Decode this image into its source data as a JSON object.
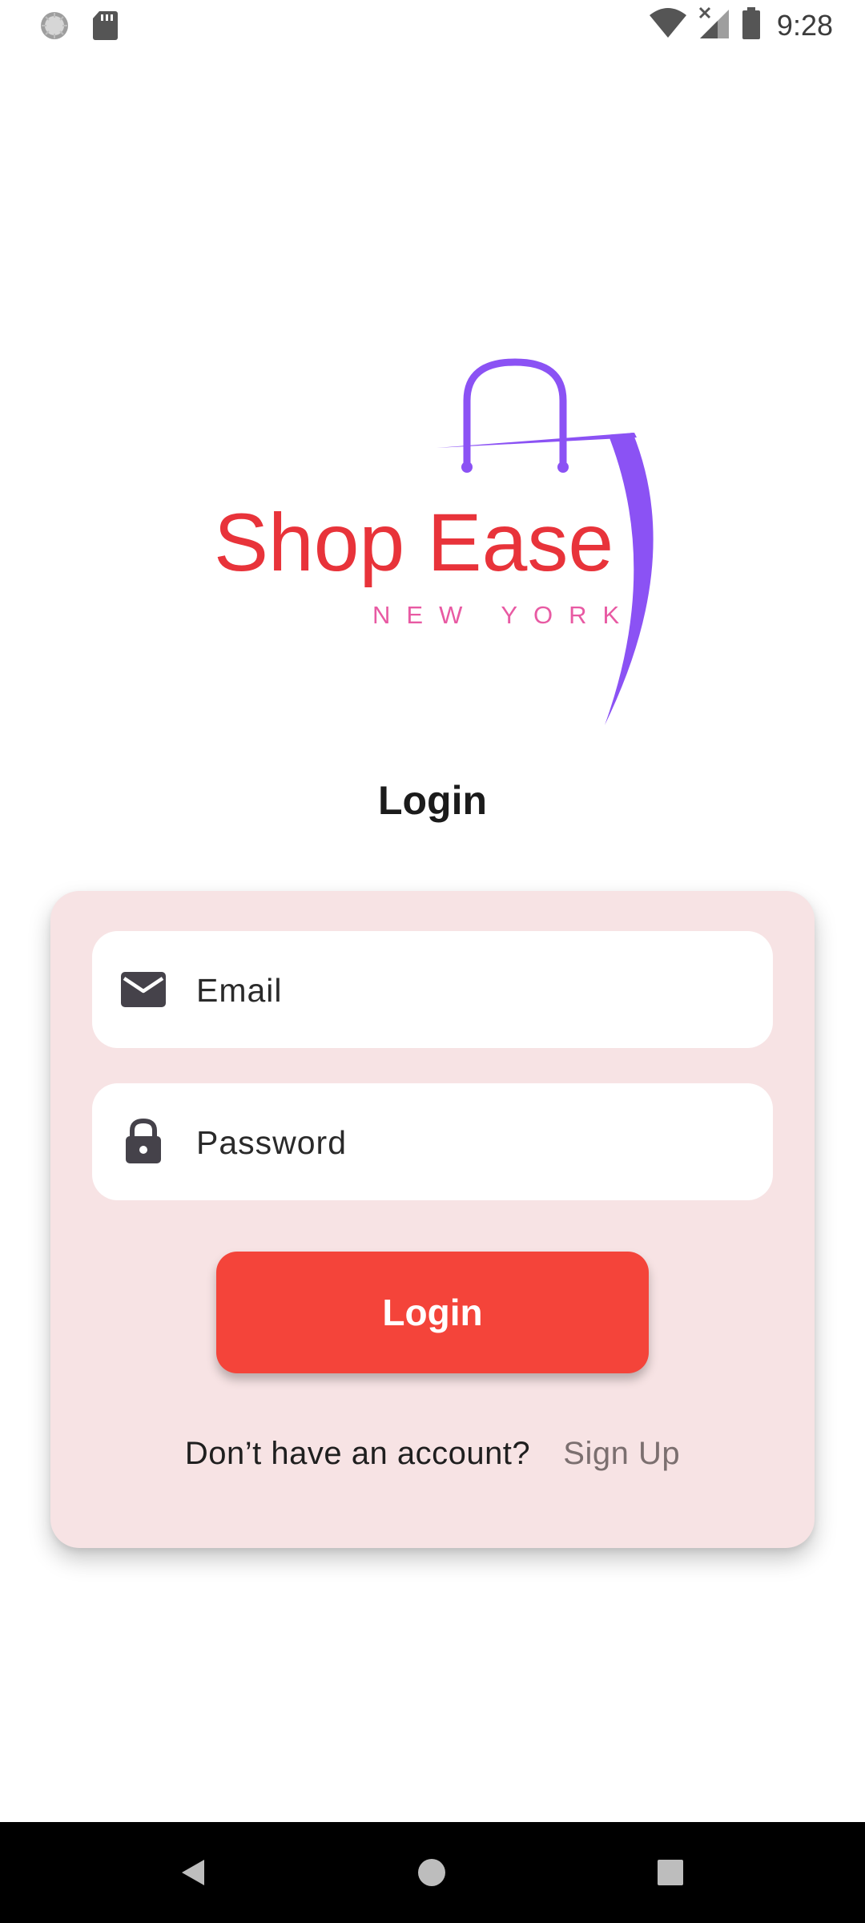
{
  "status_bar": {
    "time": "9:28",
    "icons": [
      "loading-spinner-icon",
      "sd-card-icon",
      "wifi-icon",
      "signal-no-data-icon",
      "battery-icon"
    ]
  },
  "logo": {
    "brand_name": "Shop Ease",
    "tagline": "NEW YORK",
    "colors": {
      "brand_text": "#e8333a",
      "tagline_text": "#e85aa3",
      "bag": "#8b52f4"
    }
  },
  "page": {
    "title": "Login"
  },
  "form": {
    "email": {
      "placeholder": "Email",
      "value": "",
      "icon": "mail-icon"
    },
    "password": {
      "placeholder": "Password",
      "value": "",
      "icon": "lock-icon"
    },
    "login_button_label": "Login",
    "signup_prompt": "Don’t have an account?",
    "signup_link": "Sign Up"
  },
  "colors": {
    "card_background": "#f7e3e4",
    "primary_button": "#f4443a",
    "link": "#7b6f6f"
  },
  "nav_bar": {
    "buttons": [
      "back-icon",
      "home-icon",
      "recents-icon"
    ]
  }
}
